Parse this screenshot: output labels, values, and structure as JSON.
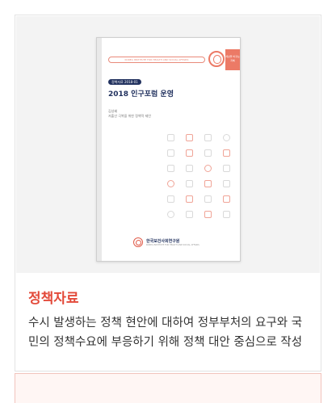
{
  "card": {
    "category": "정책자료",
    "description": "수시 발생하는 정책 현안에 대하여 정부부처의 요구와 국민의 정책수요에 부응하기 위해 정책 대안 중심으로 작성",
    "cover": {
      "series_line": "KOREA INSTITUTE FOR HEALTH AND SOCIAL AFFAIRS",
      "badge": "정책자료 2018-01",
      "title": "2018 인구포럼 운영",
      "author": "김성혜",
      "subtitle": "저출산 극복을 위한 정책적 제언",
      "tab_text": "세상을 바꾸는 지혜",
      "publisher": "한국보건사회연구원",
      "publisher_en": "KOREA INSTITUTE FOR HEALTH AND SOCIAL AFFAIRS",
      "accent_color": "#e34a3a",
      "title_color": "#22325f"
    }
  }
}
